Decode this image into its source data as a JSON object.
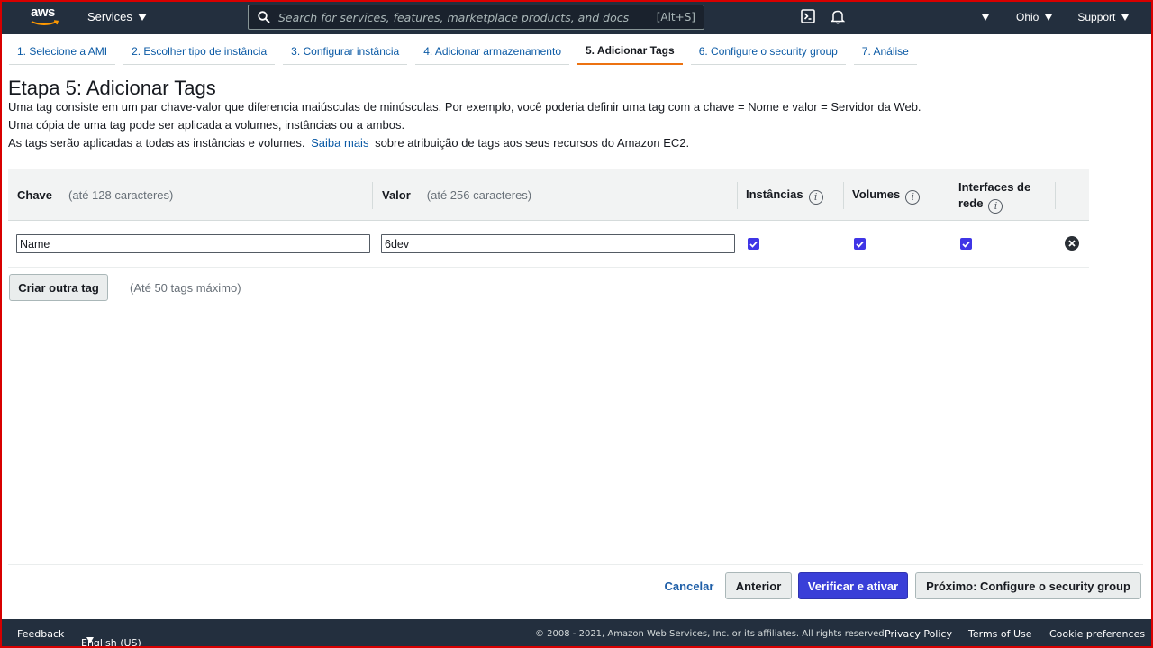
{
  "topnav": {
    "logo_text": "aws",
    "services_label": "Services",
    "search_placeholder": "Search for services, features, marketplace products, and docs",
    "search_shortcut": "[Alt+S]",
    "icons": [
      "cloudshell-icon",
      "bell-icon",
      "account-caret-icon"
    ],
    "region_label": "Ohio",
    "support_label": "Support"
  },
  "steps": [
    {
      "label": "1. Selecione a AMI",
      "active": false
    },
    {
      "label": "2. Escolher tipo de instância",
      "active": false
    },
    {
      "label": "3. Configurar instância",
      "active": false
    },
    {
      "label": "4. Adicionar armazenamento",
      "active": false
    },
    {
      "label": "5. Adicionar Tags",
      "active": true
    },
    {
      "label": "6. Configure o security group",
      "active": false
    },
    {
      "label": "7. Análise",
      "active": false
    }
  ],
  "page": {
    "title": "Etapa 5: Adicionar Tags",
    "desc_line1": "Uma tag consiste em um par chave-valor que diferencia maiúsculas de minúsculas. Por exemplo, você poderia definir uma tag com a chave = Nome e valor = Servidor da Web.",
    "desc_line2": "Uma cópia de uma tag pode ser aplicada a volumes, instâncias ou a ambos.",
    "desc_line3_pre": "As tags serão aplicadas a todas as instâncias e volumes.",
    "desc_line3_link": "Saiba mais",
    "desc_line3_post": "sobre atribuição de tags aos seus recursos do Amazon EC2."
  },
  "table": {
    "col_key": "Chave",
    "col_key_hint": "(até 128 caracteres)",
    "col_value": "Valor",
    "col_value_hint": "(até 256 caracteres)",
    "col_instances": "Instâncias",
    "col_volumes": "Volumes",
    "col_interfaces_line1": "Interfaces de",
    "col_interfaces_line2": "rede",
    "info_glyph": "i",
    "rows": [
      {
        "key": "Name",
        "value": "6dev",
        "instances": true,
        "volumes": true,
        "interfaces": true
      }
    ]
  },
  "actions": {
    "add_tag_label": "Criar outra tag",
    "limit_text": "(Até 50 tags máximo)",
    "cancel_label": "Cancelar",
    "previous_label": "Anterior",
    "review_label": "Verificar e ativar",
    "next_label": "Próximo: Configure o security group"
  },
  "footer": {
    "feedback": "Feedback",
    "language": "English (US)",
    "copyright": "© 2008 - 2021, Amazon Web Services, Inc. or its affiliates. All rights reserved.",
    "privacy": "Privacy Policy",
    "terms": "Terms of Use",
    "cookies": "Cookie preferences"
  },
  "colors": {
    "nav_bg": "#232f3e",
    "accent_orange": "#ec7211",
    "primary_button": "#3a3fd8",
    "link": "#0b5aa5",
    "checkbox": "#3f35e6"
  }
}
